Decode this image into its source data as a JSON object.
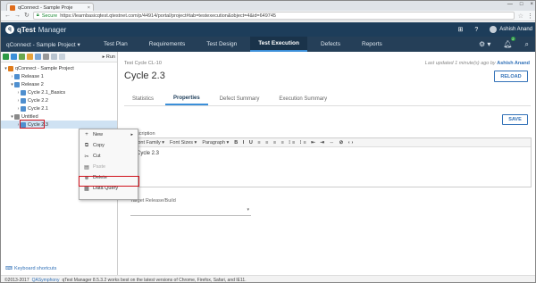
{
  "browser": {
    "tab_title": "qConnect - Sample Proje",
    "tab_close": "×",
    "window_controls": [
      "—",
      "□",
      "×"
    ],
    "secure_label": "Secure",
    "url": "https://learnbasicqtest.qtestnet.com/p/44914/portal/project#tab=testexecution&object=4&id=649745"
  },
  "app": {
    "brand_primary": "qTest",
    "brand_secondary": "Manager",
    "user_name": "Ashish Anand",
    "notification_count": "2"
  },
  "nav": {
    "project": "qConnect - Sample Project ▾",
    "tabs": [
      "Test Plan",
      "Requirements",
      "Test Design",
      "Test Execution",
      "Defects",
      "Reports"
    ],
    "active_tab": "Test Execution"
  },
  "tree": {
    "run_label": "Run",
    "nodes": [
      {
        "label": "qConnect - Sample Project",
        "indent": 0,
        "caret": "▾",
        "color": "#e07b1a"
      },
      {
        "label": "Release 1",
        "indent": 1,
        "caret": "›",
        "color": "#4f8fcf"
      },
      {
        "label": "Release 2",
        "indent": 1,
        "caret": "▾",
        "color": "#4f8fcf"
      },
      {
        "label": "Cycle 2.1_Basics",
        "indent": 2,
        "caret": "›",
        "color": "#4f8fcf"
      },
      {
        "label": "Cycle 2.2",
        "indent": 2,
        "caret": "›",
        "color": "#4f8fcf"
      },
      {
        "label": "Cycle 2.1",
        "indent": 2,
        "caret": "›",
        "color": "#4f8fcf"
      },
      {
        "label": "Untitled",
        "indent": 1,
        "caret": "▾",
        "color": "#8a8a8a"
      },
      {
        "label": "Cycle 2.3",
        "indent": 2,
        "caret": "›",
        "color": "#4f8fcf"
      }
    ],
    "selected_label": "Cycle 2.3",
    "keyboard_shortcuts": "Keyboard shortcuts"
  },
  "context_menu": {
    "items": [
      {
        "label": "New",
        "icon": "+",
        "disabled": false,
        "submenu": true
      },
      {
        "label": "Copy",
        "icon": "⧉",
        "disabled": false,
        "submenu": false
      },
      {
        "label": "Cut",
        "icon": "✂",
        "disabled": false,
        "submenu": false
      },
      {
        "label": "Paste",
        "icon": "▤",
        "disabled": true,
        "submenu": false
      },
      {
        "label": "Delete",
        "icon": "⊗",
        "disabled": false,
        "submenu": false
      },
      {
        "label": "Data Query",
        "icon": "▦",
        "disabled": false,
        "submenu": false
      }
    ]
  },
  "main": {
    "breadcrumb": "Test Cycle  CL-10",
    "updated_prefix": "Last updated 1 minute(s) ago by",
    "updated_by": "Ashish Anand",
    "title": "Cycle 2.3",
    "reload_label": "RELOAD",
    "subtabs": [
      "Statistics",
      "Properties",
      "Defect Summary",
      "Execution Summary"
    ],
    "active_subtab": "Properties",
    "save_label": "SAVE",
    "description_label": "Description",
    "editor_toolbar": {
      "font_family": "Font Family ▾",
      "font_sizes": "Font Sizes ▾",
      "paragraph": "Paragraph ▾",
      "formatting": "B I U ≡ ≡ ≡ ≡ ⁝≡ ⁝≡ ⇤ ⇥ ⇔ ⊘ ‹›"
    },
    "description_text": "Cycle 2.3",
    "target_label": "Target Release/Build",
    "target_caret": "▾"
  },
  "status": {
    "copyright_prefix": "©2013-2017",
    "company": "QASymphony",
    "notice": "qTest Manager 8.5.3.2 works best on the latest versions of Chrome, Firefox, Safari, and IE11."
  },
  "colors": {
    "appbar": "#1d3d5a",
    "navbar": "#253f58",
    "accent": "#3372b8",
    "highlight": "#d0111b"
  }
}
